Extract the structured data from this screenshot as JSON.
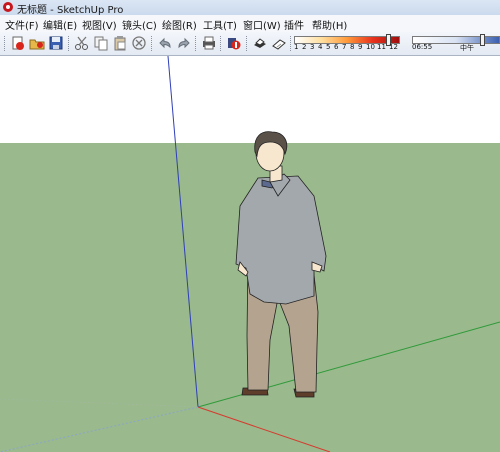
{
  "window": {
    "title": "无标题 - SketchUp Pro"
  },
  "menu": {
    "items": [
      {
        "label": "文件(F)"
      },
      {
        "label": "编辑(E)"
      },
      {
        "label": "视图(V)"
      },
      {
        "label": "镜头(C)"
      },
      {
        "label": "绘图(R)"
      },
      {
        "label": "工具(T)"
      },
      {
        "label": "窗口(W)"
      },
      {
        "label": "插件"
      },
      {
        "label": "帮助(H)"
      }
    ]
  },
  "toolbar": {
    "buttons": [
      {
        "icon": "new-icon"
      },
      {
        "icon": "open-icon"
      },
      {
        "icon": "save-icon"
      },
      {
        "icon": "cut-icon"
      },
      {
        "icon": "copy-icon"
      },
      {
        "icon": "paste-icon"
      },
      {
        "icon": "erase-icon"
      },
      {
        "icon": "undo-icon"
      },
      {
        "icon": "redo-icon"
      },
      {
        "icon": "print-icon"
      },
      {
        "icon": "model-info-icon"
      },
      {
        "icon": "shadow-toggle-icon"
      },
      {
        "icon": "fog-icon"
      }
    ]
  },
  "shadows": {
    "month_ticks": [
      "1",
      "2",
      "3",
      "4",
      "5",
      "6",
      "7",
      "8",
      "9",
      "10",
      "11",
      "12"
    ],
    "month_value": 11,
    "time_label": "06:55",
    "noon_label": "中午"
  },
  "colors": {
    "sky": "#ffffff",
    "ground": "#9ab98c",
    "axis_red": "#d63a2f",
    "axis_green": "#2f9a3a",
    "axis_blue": "#2f3fb8",
    "figure_sweater": "#a3a8ad",
    "figure_pants": "#b3a38f",
    "figure_skin": "#f8e7cf",
    "figure_hair": "#5a5149",
    "figure_shoes": "#5e3d2b"
  }
}
